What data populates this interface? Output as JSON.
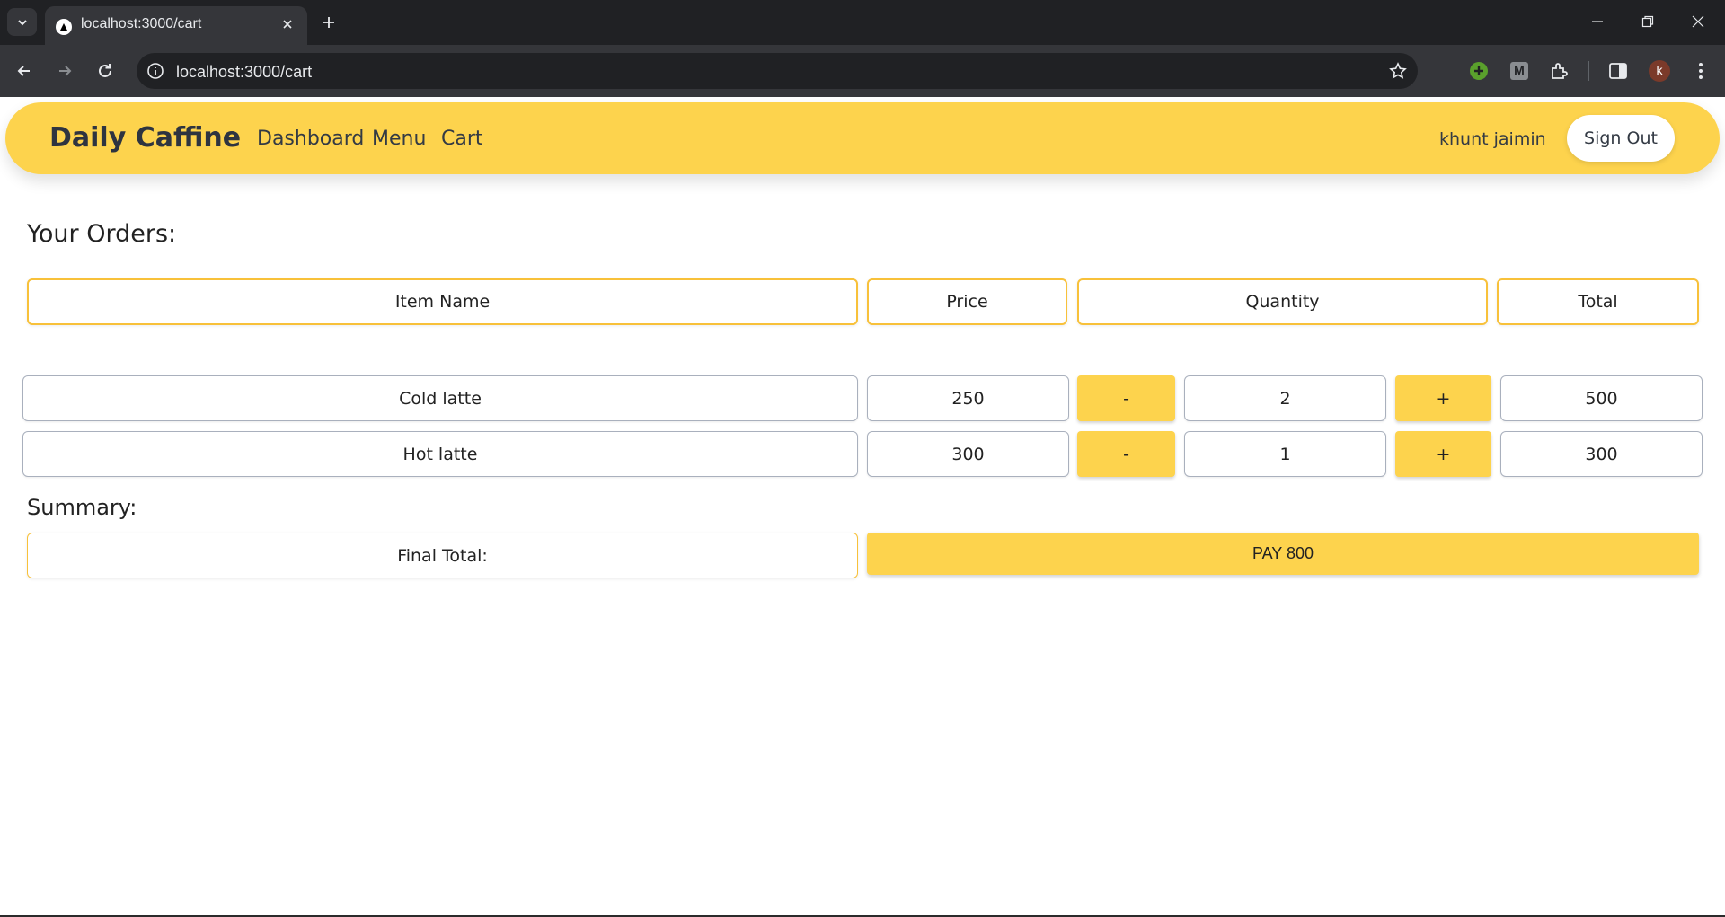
{
  "browser": {
    "tab_title": "localhost:3000/cart",
    "url": "localhost:3000/cart",
    "profile_initial": "k",
    "extension_m_label": "M"
  },
  "navbar": {
    "brand": "Daily Caffine",
    "links": [
      "Dashboard",
      "Menu",
      "Cart"
    ],
    "username": "khunt jaimin",
    "signout_label": "Sign Out",
    "bg_color": "#fdd34d"
  },
  "orders": {
    "heading": "Your Orders:",
    "headers": {
      "item": "Item Name",
      "price": "Price",
      "quantity": "Quantity",
      "total": "Total"
    },
    "minus_label": "-",
    "plus_label": "+",
    "rows": [
      {
        "name": "Cold latte",
        "price": "250",
        "quantity": "2",
        "total": "500"
      },
      {
        "name": "Hot latte",
        "price": "300",
        "quantity": "1",
        "total": "300"
      }
    ]
  },
  "summary": {
    "heading": "Summary:",
    "final_total_label": "Final Total:",
    "pay_label": "PAY 800"
  },
  "colors": {
    "accent": "#fdd34d",
    "header_border": "#f8c13a",
    "chrome_dark": "#202124",
    "chrome_toolbar": "#35363a"
  }
}
